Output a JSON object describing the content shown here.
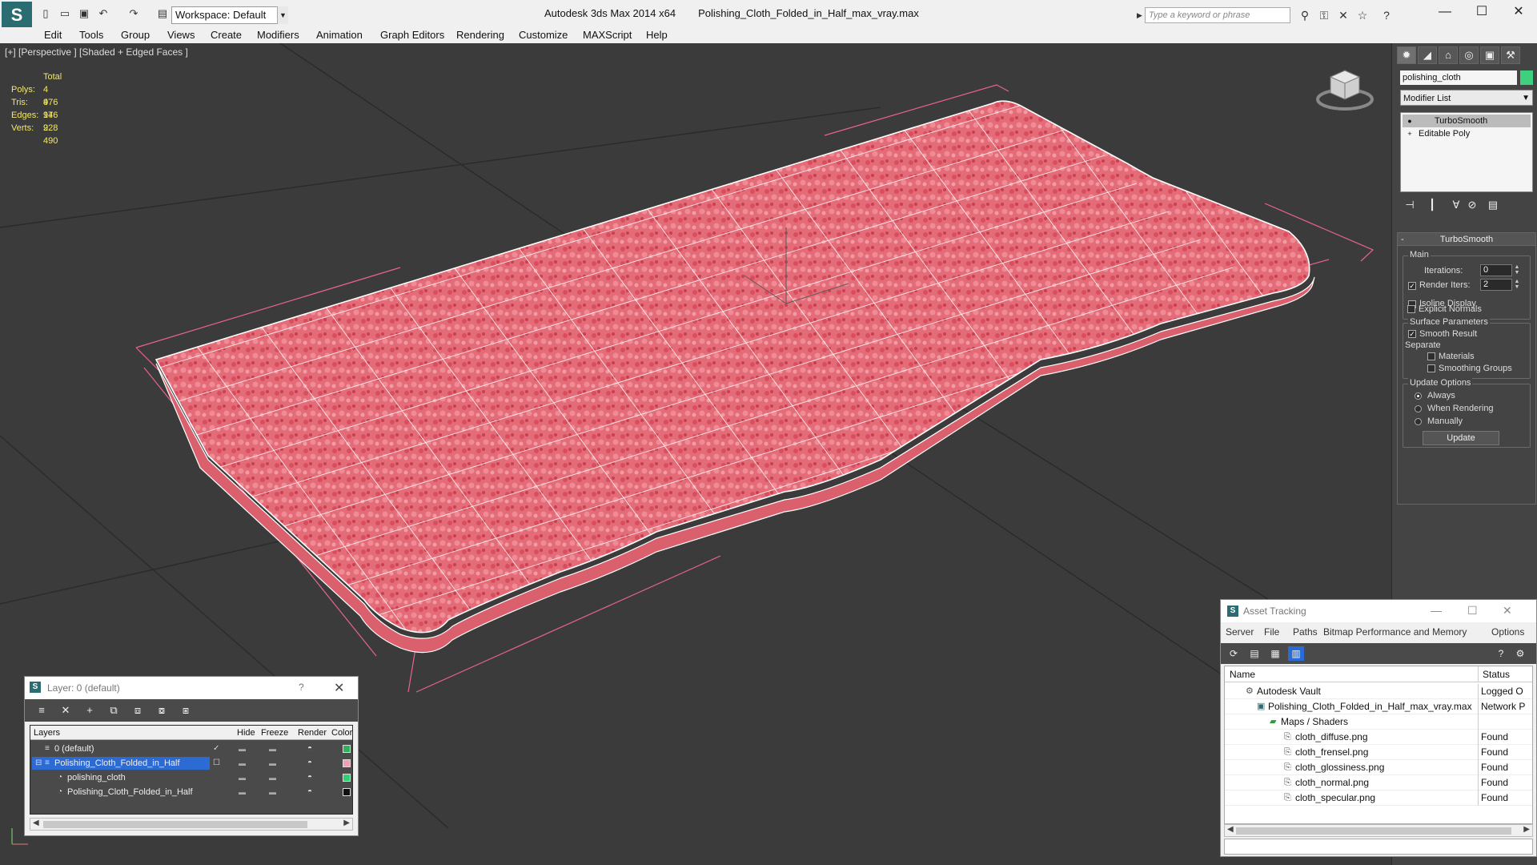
{
  "titlebar": {
    "workspace": "Workspace: Default",
    "app_title": "Autodesk 3ds Max  2014 x64",
    "file_name": "Polishing_Cloth_Folded_in_Half_max_vray.max",
    "search_placeholder": "Type a keyword or phrase",
    "minimize": "—",
    "maximize": "☐",
    "close": "✕"
  },
  "menu": [
    "Edit",
    "Tools",
    "Group",
    "Views",
    "Create",
    "Modifiers",
    "Animation",
    "Graph Editors",
    "Rendering",
    "Customize",
    "MAXScript",
    "Help"
  ],
  "viewport": {
    "label": "[+] [Perspective ] [Shaded + Edged Faces ]",
    "stats": {
      "header": "Total",
      "rows": [
        {
          "k": "Polys:",
          "v": "4 976"
        },
        {
          "k": "Tris:",
          "v": "4 976"
        },
        {
          "k": "Edges:",
          "v": "14 928"
        },
        {
          "k": "Verts:",
          "v": "2 490"
        }
      ]
    },
    "cloth_color": "#e06a75",
    "bbox_color": "#e8648a"
  },
  "command_panel": {
    "object_name": "polishing_cloth",
    "object_color": "#3fd07f",
    "modifier_list": "Modifier List",
    "stack": [
      "TurboSmooth",
      "Editable Poly"
    ],
    "rollout": {
      "title": "TurboSmooth",
      "main_group": "Main",
      "iterations_label": "Iterations:",
      "iterations_value": "0",
      "render_iters_label": "Render Iters:",
      "render_iters_value": "2",
      "render_iters_checked": true,
      "isoline_label": "Isoline Display",
      "explicit_normals_label": "Explicit Normals",
      "surface_group": "Surface Parameters",
      "smooth_result_label": "Smooth Result",
      "separate_label": "Separate",
      "materials_label": "Materials",
      "smoothing_groups_label": "Smoothing Groups",
      "update_group": "Update Options",
      "always_label": "Always",
      "when_rendering_label": "When Rendering",
      "manually_label": "Manually",
      "update_button": "Update"
    }
  },
  "layer_window": {
    "title": "Layer: 0 (default)",
    "help": "?",
    "close": "✕",
    "columns": [
      "Layers",
      "Hide",
      "Freeze",
      "Render",
      "Color"
    ],
    "rows": [
      {
        "name": "0 (default)",
        "indent": 0,
        "color": "#2fb05a",
        "active": true
      },
      {
        "name": "Polishing_Cloth_Folded_in_Half",
        "indent": 0,
        "color": "#f0a0b0",
        "selected": true
      },
      {
        "name": "polishing_cloth",
        "indent": 1,
        "color": "#2fd070"
      },
      {
        "name": "Polishing_Cloth_Folded_in_Half",
        "indent": 1,
        "color": "#111111"
      }
    ]
  },
  "asset_window": {
    "title": "Asset Tracking",
    "menu": [
      "Server",
      "File",
      "Paths",
      "Bitmap Performance and Memory",
      "Options"
    ],
    "columns": [
      "Name",
      "Status"
    ],
    "rows": [
      {
        "name": "Autodesk Vault",
        "status": "Logged O",
        "indent": 1
      },
      {
        "name": "Polishing_Cloth_Folded_in_Half_max_vray.max",
        "status": "Network P",
        "indent": 2
      },
      {
        "name": "Maps / Shaders",
        "status": "",
        "indent": 3
      },
      {
        "name": "cloth_diffuse.png",
        "status": "Found",
        "indent": 4
      },
      {
        "name": "cloth_frensel.png",
        "status": "Found",
        "indent": 4
      },
      {
        "name": "cloth_glossiness.png",
        "status": "Found",
        "indent": 4
      },
      {
        "name": "cloth_normal.png",
        "status": "Found",
        "indent": 4
      },
      {
        "name": "cloth_specular.png",
        "status": "Found",
        "indent": 4
      }
    ]
  }
}
